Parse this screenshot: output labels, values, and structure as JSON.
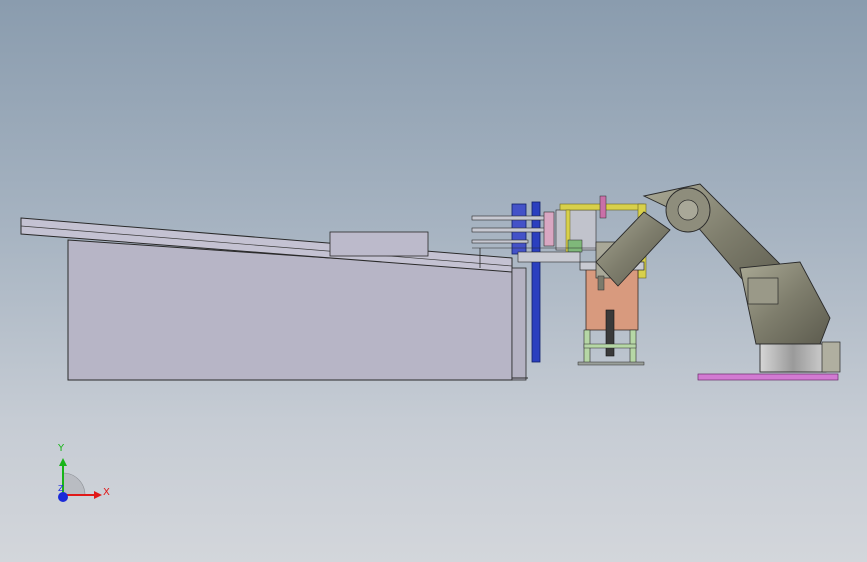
{
  "viewport": {
    "background_top": "#8a9cae",
    "background_bottom": "#d3d6db"
  },
  "model": {
    "components": [
      "inclined-conveyor",
      "machine-frame",
      "gripper-fixture",
      "fixture-stand",
      "industrial-robot",
      "robot-base-plate"
    ],
    "colors": {
      "conveyor_fill": "#b6b4c4",
      "line": "#2a2a2a",
      "fixture_copper": "#d89a7e",
      "robot_body": "#8b8a78",
      "frame_yellow": "#d8d04a",
      "frame_blue": "#2b3fbf",
      "base_plate": "#d27ad2"
    }
  },
  "triad": {
    "x_label": "X",
    "y_label": "Y",
    "z_label": "Z",
    "x_color": "#e01919",
    "y_color": "#18b418",
    "z_color": "#1a2ad8"
  }
}
